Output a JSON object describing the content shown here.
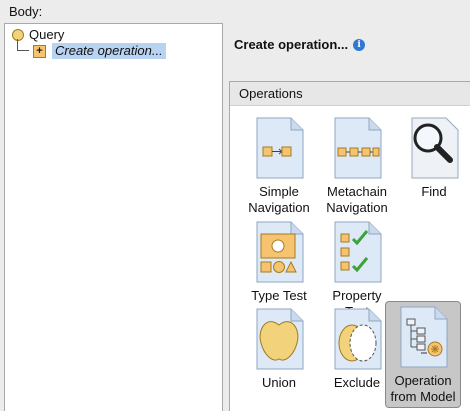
{
  "body_label": "Body:",
  "tree": {
    "root_label": "Query",
    "child_label": "Create operation...",
    "child_icon": "+"
  },
  "heading": "Create operation...",
  "info_icon": "i",
  "operations_title": "Operations",
  "operations": [
    {
      "id": "simple-navigation",
      "label": "Simple Navigation",
      "icon": "simple-navigation-icon",
      "selected": false
    },
    {
      "id": "metachain-navigation",
      "label": "Metachain Navigation",
      "icon": "metachain-navigation-icon",
      "selected": false
    },
    {
      "id": "find",
      "label": "Find",
      "icon": "magnifier-icon",
      "selected": false
    },
    {
      "id": "type-test",
      "label": "Type Test",
      "icon": "type-test-icon",
      "selected": false
    },
    {
      "id": "property-test",
      "label": "Property Test",
      "icon": "property-test-icon",
      "selected": false
    },
    {
      "id": "union",
      "label": "Union",
      "icon": "union-icon",
      "selected": false
    },
    {
      "id": "exclude",
      "label": "Exclude",
      "icon": "exclude-icon",
      "selected": false
    },
    {
      "id": "operation-from-model",
      "label": "Operation from Model",
      "icon": "operation-from-model-icon",
      "selected": true
    }
  ],
  "colors": {
    "selection_highlight": "#b8d2f2",
    "icon_yellow": "#f6c46e",
    "check_green": "#3aa33a",
    "doc_blue": "#dde9f7"
  }
}
